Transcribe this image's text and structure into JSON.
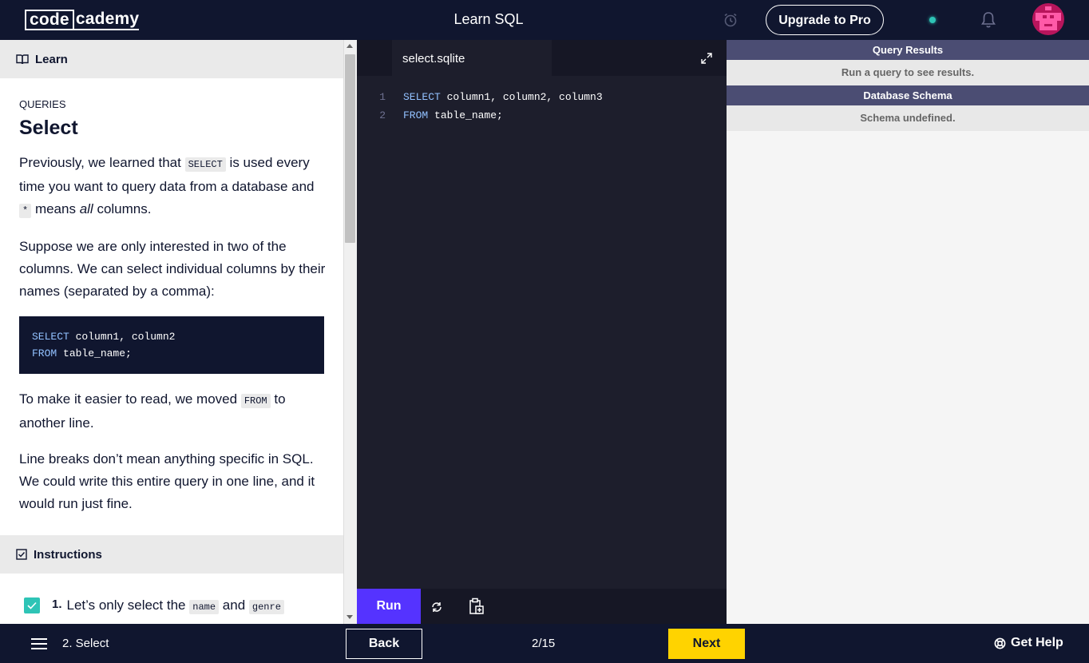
{
  "header": {
    "logo_left": "code",
    "logo_right": "cademy",
    "course_title": "Learn SQL",
    "upgrade_label": "Upgrade to Pro"
  },
  "learn": {
    "header_label": "Learn",
    "eyebrow": "QUERIES",
    "title": "Select",
    "p1_a": "Previously, we learned that",
    "p1_code1": "SELECT",
    "p1_b": "is used every time you want to query data from a database and",
    "p1_code2": "*",
    "p1_c": "means",
    "p1_em": "all",
    "p1_d": "columns.",
    "p2": "Suppose we are only interested in two of the columns. We can select individual columns by their names (separated by a comma):",
    "code_line1_kw": "SELECT",
    "code_line1_rest": " column1, column2",
    "code_line2_kw": "FROM",
    "code_line2_rest": " table_name;",
    "p3_a": "To make it easier to read, we moved",
    "p3_code": "FROM",
    "p3_b": "to another line.",
    "p4": "Line breaks don’t mean anything specific in SQL. We could write this entire query in one line, and it would run just fine.",
    "instructions_label": "Instructions",
    "task_number": "1.",
    "task_a": "Let’s only select the",
    "task_code1": "name",
    "task_b": "and",
    "task_code2": "genre"
  },
  "editor": {
    "file_name": "select.sqlite",
    "lines": [
      {
        "num": "1",
        "kw": "SELECT",
        "rest": " column1, column2, column3"
      },
      {
        "num": "2",
        "kw": "FROM",
        "rest": " table_name;"
      }
    ],
    "run_label": "Run"
  },
  "results": {
    "query_results_title": "Query Results",
    "query_results_body": "Run a query to see results.",
    "schema_title": "Database Schema",
    "schema_body": "Schema undefined."
  },
  "footer": {
    "lesson_step": "2. Select",
    "back_label": "Back",
    "progress": "2/15",
    "next_label": "Next",
    "help_label": "Get Help"
  },
  "colors": {
    "run": "#5533ff",
    "next": "#ffd300",
    "checkbox": "#2ec4b6",
    "navy": "#10162f"
  }
}
